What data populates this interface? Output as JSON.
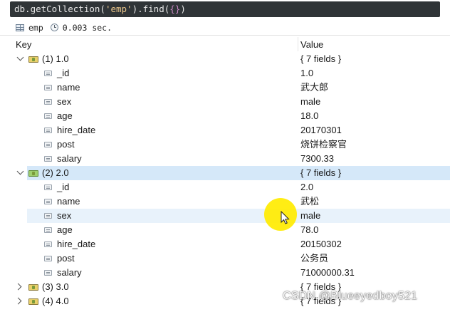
{
  "query": {
    "ident": "db.getCollection(",
    "arg": "'emp'",
    "close": ").find(",
    "brace": "{}",
    "end": ")"
  },
  "status": {
    "collection": "emp",
    "elapsed": "0.003 sec."
  },
  "columns": {
    "key": "Key",
    "value": "Value"
  },
  "rows": [
    {
      "kind": "doc",
      "key": "(1) 1.0",
      "value": "{ 7 fields }",
      "expanded": true
    },
    {
      "kind": "field",
      "key": "_id",
      "value": "1.0"
    },
    {
      "kind": "field",
      "key": "name",
      "value": "武大郎"
    },
    {
      "kind": "field",
      "key": "sex",
      "value": "male"
    },
    {
      "kind": "field",
      "key": "age",
      "value": "18.0"
    },
    {
      "kind": "field",
      "key": "hire_date",
      "value": "20170301"
    },
    {
      "kind": "field",
      "key": "post",
      "value": "烧饼检察官"
    },
    {
      "kind": "field",
      "key": "salary",
      "value": "7300.33"
    },
    {
      "kind": "doc",
      "key": "(2) 2.0",
      "value": "{ 7 fields }",
      "expanded": true,
      "selected": true
    },
    {
      "kind": "field",
      "key": "_id",
      "value": "2.0"
    },
    {
      "kind": "field",
      "key": "name",
      "value": "武松"
    },
    {
      "kind": "field",
      "key": "sex",
      "value": "male",
      "hover": true
    },
    {
      "kind": "field",
      "key": "age",
      "value": "78.0"
    },
    {
      "kind": "field",
      "key": "hire_date",
      "value": "20150302"
    },
    {
      "kind": "field",
      "key": "post",
      "value": "公务员"
    },
    {
      "kind": "field",
      "key": "salary",
      "value": "71000000.31"
    },
    {
      "kind": "doc",
      "key": "(3) 3.0",
      "value": "{ 7 fields }",
      "expanded": false
    },
    {
      "kind": "doc",
      "key": "(4) 4.0",
      "value": "{ 7 fields }",
      "expanded": false
    }
  ],
  "watermark": "CSDN @Blueeyedboy521",
  "icons": {
    "status_collection": "grid-icon",
    "status_time": "clock-icon",
    "document": "document-icon",
    "field": "field-icon"
  }
}
